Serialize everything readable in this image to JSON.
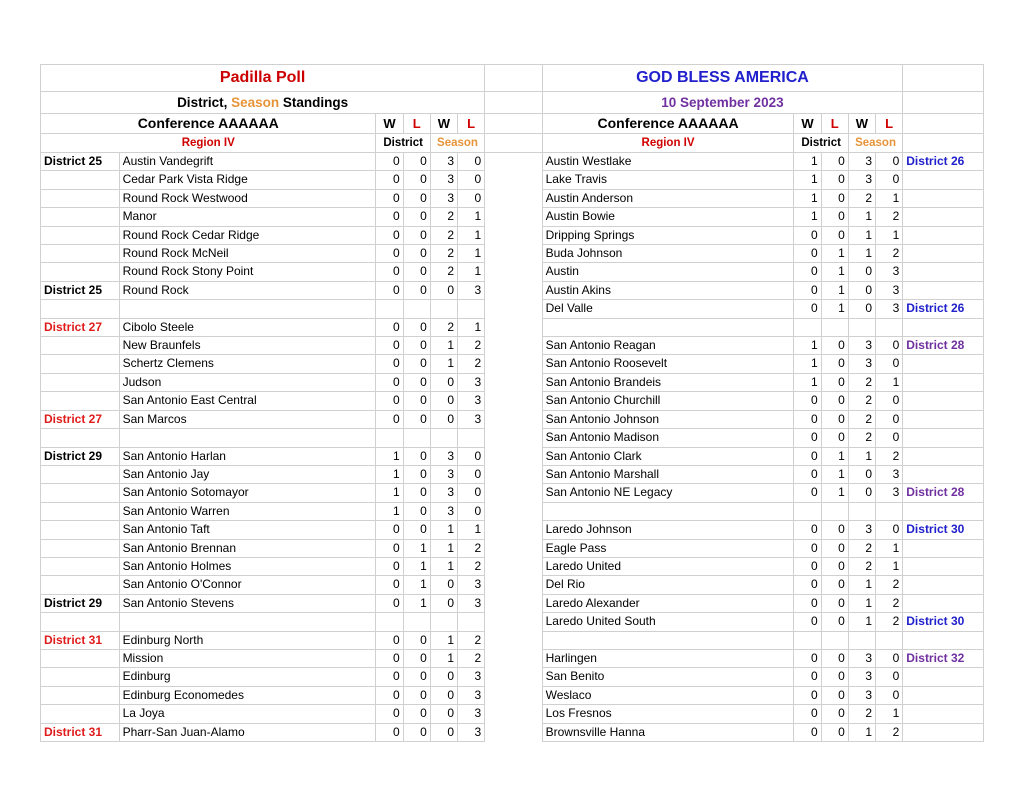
{
  "header": {
    "left_title": "Padilla Poll",
    "left_subtitle_pre": "District, ",
    "left_subtitle_season": "Season",
    "left_subtitle_post": " Standings",
    "right_title": "GOD BLESS AMERICA",
    "right_date": "10 September 2023",
    "conference_left": "Conference AAAAAA",
    "conference_right": "Conference AAAAAA",
    "region_left": "Region IV",
    "region_right": "Region IV",
    "col_w": "W",
    "col_l": "L",
    "group_district": "District",
    "group_season": "Season",
    "colors": {
      "left_title": "#CC0000",
      "right_title": "#2020CC",
      "right_date": "#7030A0",
      "season": "#E79439",
      "loss_header": "#D00000",
      "region": "#D00000",
      "district_red": "#E01B1B",
      "district_blue": "#2020CC",
      "district_purple": "#7030A0",
      "district_black": "#000000",
      "gridline": "#d0d0d0"
    }
  },
  "rows": [
    {
      "dl": "District 25",
      "dlc": "k-black",
      "team_l": "Austin Vandegrift",
      "l": [
        "0",
        "0",
        "3",
        "0"
      ],
      "team_r": "Austin Westlake",
      "r": [
        "1",
        "0",
        "3",
        "0"
      ],
      "dr": "District 26",
      "drc": "k-blue"
    },
    {
      "dl": "",
      "dlc": "k-black",
      "team_l": "Cedar Park Vista Ridge",
      "l": [
        "0",
        "0",
        "3",
        "0"
      ],
      "team_r": "Lake Travis",
      "r": [
        "1",
        "0",
        "3",
        "0"
      ],
      "dr": "",
      "drc": "k-blue"
    },
    {
      "dl": "",
      "dlc": "k-black",
      "team_l": "Round Rock Westwood",
      "l": [
        "0",
        "0",
        "3",
        "0"
      ],
      "team_r": "Austin Anderson",
      "r": [
        "1",
        "0",
        "2",
        "1"
      ],
      "dr": "",
      "drc": "k-blue"
    },
    {
      "dl": "",
      "dlc": "k-black",
      "team_l": "Manor",
      "l": [
        "0",
        "0",
        "2",
        "1"
      ],
      "team_r": "Austin Bowie",
      "r": [
        "1",
        "0",
        "1",
        "2"
      ],
      "dr": "",
      "drc": "k-blue"
    },
    {
      "dl": "",
      "dlc": "k-black",
      "team_l": "Round Rock Cedar Ridge",
      "l": [
        "0",
        "0",
        "2",
        "1"
      ],
      "team_r": "Dripping Springs",
      "r": [
        "0",
        "0",
        "1",
        "1"
      ],
      "dr": "",
      "drc": "k-blue"
    },
    {
      "dl": "",
      "dlc": "k-black",
      "team_l": "Round Rock McNeil",
      "l": [
        "0",
        "0",
        "2",
        "1"
      ],
      "team_r": "Buda Johnson",
      "r": [
        "0",
        "1",
        "1",
        "2"
      ],
      "dr": "",
      "drc": "k-blue"
    },
    {
      "dl": "",
      "dlc": "k-black",
      "team_l": "Round Rock Stony Point",
      "l": [
        "0",
        "0",
        "2",
        "1"
      ],
      "team_r": "Austin",
      "r": [
        "0",
        "1",
        "0",
        "3"
      ],
      "dr": "",
      "drc": "k-blue"
    },
    {
      "dl": "District 25",
      "dlc": "k-black",
      "team_l": "Round Rock",
      "l": [
        "0",
        "0",
        "0",
        "3"
      ],
      "team_r": "Austin Akins",
      "r": [
        "0",
        "1",
        "0",
        "3"
      ],
      "dr": "",
      "drc": "k-blue"
    },
    {
      "dl": "",
      "dlc": "k-black",
      "team_l": "",
      "l": [
        "",
        "",
        "",
        ""
      ],
      "team_r": "Del Valle",
      "r": [
        "0",
        "1",
        "0",
        "3"
      ],
      "dr": "District 26",
      "drc": "k-blue"
    },
    {
      "dl": "District 27",
      "dlc": "k-red",
      "team_l": "Cibolo Steele",
      "l": [
        "0",
        "0",
        "2",
        "1"
      ],
      "team_r": "",
      "r": [
        "",
        "",
        "",
        ""
      ],
      "dr": "",
      "drc": "k-purple"
    },
    {
      "dl": "",
      "dlc": "k-red",
      "team_l": "New Braunfels",
      "l": [
        "0",
        "0",
        "1",
        "2"
      ],
      "team_r": "San Antonio Reagan",
      "r": [
        "1",
        "0",
        "3",
        "0"
      ],
      "dr": "District 28",
      "drc": "k-purple"
    },
    {
      "dl": "",
      "dlc": "k-red",
      "team_l": "Schertz Clemens",
      "l": [
        "0",
        "0",
        "1",
        "2"
      ],
      "team_r": "San Antonio Roosevelt",
      "r": [
        "1",
        "0",
        "3",
        "0"
      ],
      "dr": "",
      "drc": "k-purple"
    },
    {
      "dl": "",
      "dlc": "k-red",
      "team_l": "Judson",
      "l": [
        "0",
        "0",
        "0",
        "3"
      ],
      "team_r": "San Antonio Brandeis",
      "r": [
        "1",
        "0",
        "2",
        "1"
      ],
      "dr": "",
      "drc": "k-purple"
    },
    {
      "dl": "",
      "dlc": "k-red",
      "team_l": "San Antonio East Central",
      "l": [
        "0",
        "0",
        "0",
        "3"
      ],
      "team_r": "San Antonio Churchill",
      "r": [
        "0",
        "0",
        "2",
        "0"
      ],
      "dr": "",
      "drc": "k-purple"
    },
    {
      "dl": "District 27",
      "dlc": "k-red",
      "team_l": "San Marcos",
      "l": [
        "0",
        "0",
        "0",
        "3"
      ],
      "team_r": "San Antonio Johnson",
      "r": [
        "0",
        "0",
        "2",
        "0"
      ],
      "dr": "",
      "drc": "k-purple"
    },
    {
      "dl": "",
      "dlc": "k-red",
      "team_l": "",
      "l": [
        "",
        "",
        "",
        ""
      ],
      "team_r": "San Antonio Madison",
      "r": [
        "0",
        "0",
        "2",
        "0"
      ],
      "dr": "",
      "drc": "k-purple"
    },
    {
      "dl": "District 29",
      "dlc": "k-black",
      "team_l": "San Antonio Harlan",
      "l": [
        "1",
        "0",
        "3",
        "0"
      ],
      "team_r": "San Antonio Clark",
      "r": [
        "0",
        "1",
        "1",
        "2"
      ],
      "dr": "",
      "drc": "k-purple"
    },
    {
      "dl": "",
      "dlc": "k-black",
      "team_l": "San Antonio Jay",
      "l": [
        "1",
        "0",
        "3",
        "0"
      ],
      "team_r": "San Antonio Marshall",
      "r": [
        "0",
        "1",
        "0",
        "3"
      ],
      "dr": "",
      "drc": "k-purple"
    },
    {
      "dl": "",
      "dlc": "k-black",
      "team_l": "San Antonio Sotomayor",
      "l": [
        "1",
        "0",
        "3",
        "0"
      ],
      "team_r": "San Antonio NE Legacy",
      "r": [
        "0",
        "1",
        "0",
        "3"
      ],
      "dr": "District 28",
      "drc": "k-purple"
    },
    {
      "dl": "",
      "dlc": "k-black",
      "team_l": "San Antonio Warren",
      "l": [
        "1",
        "0",
        "3",
        "0"
      ],
      "team_r": "",
      "r": [
        "",
        "",
        "",
        ""
      ],
      "dr": "",
      "drc": "k-blue"
    },
    {
      "dl": "",
      "dlc": "k-black",
      "team_l": "San Antonio Taft",
      "l": [
        "0",
        "0",
        "1",
        "1"
      ],
      "team_r": "Laredo Johnson",
      "r": [
        "0",
        "0",
        "3",
        "0"
      ],
      "dr": "District 30",
      "drc": "k-blue"
    },
    {
      "dl": "",
      "dlc": "k-black",
      "team_l": "San Antonio Brennan",
      "l": [
        "0",
        "1",
        "1",
        "2"
      ],
      "team_r": "Eagle Pass",
      "r": [
        "0",
        "0",
        "2",
        "1"
      ],
      "dr": "",
      "drc": "k-blue"
    },
    {
      "dl": "",
      "dlc": "k-black",
      "team_l": "San Antonio Holmes",
      "l": [
        "0",
        "1",
        "1",
        "2"
      ],
      "team_r": "Laredo United",
      "r": [
        "0",
        "0",
        "2",
        "1"
      ],
      "dr": "",
      "drc": "k-blue"
    },
    {
      "dl": "",
      "dlc": "k-black",
      "team_l": "San Antonio O'Connor",
      "l": [
        "0",
        "1",
        "0",
        "3"
      ],
      "team_r": "Del Rio",
      "r": [
        "0",
        "0",
        "1",
        "2"
      ],
      "dr": "",
      "drc": "k-blue"
    },
    {
      "dl": "District 29",
      "dlc": "k-black",
      "team_l": "San Antonio Stevens",
      "l": [
        "0",
        "1",
        "0",
        "3"
      ],
      "team_r": "Laredo Alexander",
      "r": [
        "0",
        "0",
        "1",
        "2"
      ],
      "dr": "",
      "drc": "k-blue"
    },
    {
      "dl": "",
      "dlc": "k-black",
      "team_l": "",
      "l": [
        "",
        "",
        "",
        ""
      ],
      "team_r": "Laredo United South",
      "r": [
        "0",
        "0",
        "1",
        "2"
      ],
      "dr": "District 30",
      "drc": "k-blue"
    },
    {
      "dl": "District 31",
      "dlc": "k-red",
      "team_l": "Edinburg North",
      "l": [
        "0",
        "0",
        "1",
        "2"
      ],
      "team_r": "",
      "r": [
        "",
        "",
        "",
        ""
      ],
      "dr": "",
      "drc": "k-purple"
    },
    {
      "dl": "",
      "dlc": "k-red",
      "team_l": "Mission",
      "l": [
        "0",
        "0",
        "1",
        "2"
      ],
      "team_r": "Harlingen",
      "r": [
        "0",
        "0",
        "3",
        "0"
      ],
      "dr": "District 32",
      "drc": "k-purple"
    },
    {
      "dl": "",
      "dlc": "k-red",
      "team_l": "Edinburg",
      "l": [
        "0",
        "0",
        "0",
        "3"
      ],
      "team_r": "San Benito",
      "r": [
        "0",
        "0",
        "3",
        "0"
      ],
      "dr": "",
      "drc": "k-purple"
    },
    {
      "dl": "",
      "dlc": "k-red",
      "team_l": "Edinburg Economedes",
      "l": [
        "0",
        "0",
        "0",
        "3"
      ],
      "team_r": "Weslaco",
      "r": [
        "0",
        "0",
        "3",
        "0"
      ],
      "dr": "",
      "drc": "k-purple"
    },
    {
      "dl": "",
      "dlc": "k-red",
      "team_l": "La Joya",
      "l": [
        "0",
        "0",
        "0",
        "3"
      ],
      "team_r": "Los Fresnos",
      "r": [
        "0",
        "0",
        "2",
        "1"
      ],
      "dr": "",
      "drc": "k-purple"
    },
    {
      "dl": "District 31",
      "dlc": "k-red",
      "team_l": "Pharr-San Juan-Alamo",
      "l": [
        "0",
        "0",
        "0",
        "3"
      ],
      "team_r": "Brownsville Hanna",
      "r": [
        "0",
        "0",
        "1",
        "2"
      ],
      "dr": "",
      "drc": "k-purple"
    }
  ]
}
